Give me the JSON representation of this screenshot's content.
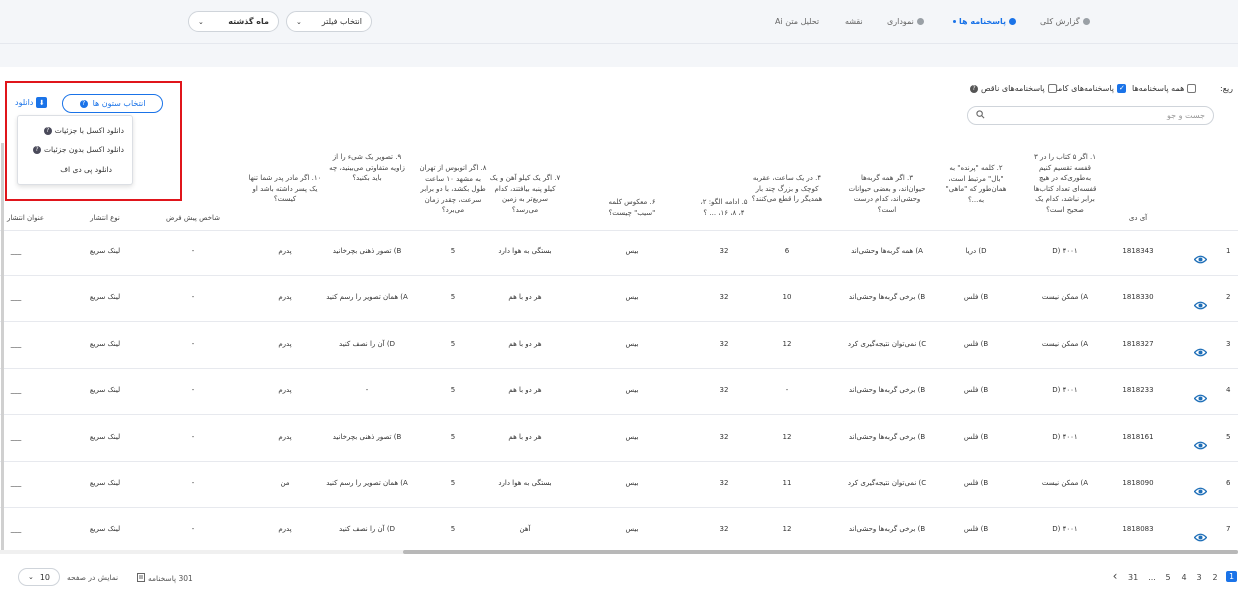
{
  "nav": {
    "tabs": [
      {
        "label": "گزارش کلی",
        "active": false
      },
      {
        "label": "پاسخنامه ها",
        "active": true
      },
      {
        "label": "نموداری",
        "active": false
      },
      {
        "label": "نقشه",
        "active": false
      },
      {
        "label": "تحلیل متن Ai",
        "active": false
      }
    ],
    "filter_select": "انتخاب فیلتر",
    "period_select": "ماه گذشته"
  },
  "filters": {
    "prefix": "ریع:",
    "all": "همه پاسخنامه‌ها",
    "complete": "پاسخنامه‌های کامل",
    "incomplete": "پاسخنامه‌های ناقص",
    "all_checked": false,
    "complete_checked": true,
    "incomplete_checked": false
  },
  "search": {
    "placeholder": "جست و جو"
  },
  "toolbar": {
    "columns_button": "انتخاب ستون ها",
    "download": "دانلود"
  },
  "download_menu": [
    {
      "label": "دانلود اکسل با جزئیات",
      "help": true
    },
    {
      "label": "دانلود اکسل بدون جزئیات",
      "help": true
    },
    {
      "label": "دانلود پی دی اف",
      "help": false
    }
  ],
  "table": {
    "headers": {
      "row": "دیف",
      "id": "آی دی",
      "q1": "۱. اگر ۵ کتاب را در ۳ قفسه تقسیم کنیم به‌طوری‌که در هیچ قفسه‌ای تعداد کتاب‌ها برابر نباشد، کدام یک صحیح است؟",
      "q2": "۲. کلمه \"پرنده\" به \"بال\" مرتبط است، همان‌طور که \"ماهی\" به...؟",
      "q3": "۳. اگر همه گربه‌ها حیوان‌اند، و بعضی حیوانات وحشی‌اند، کدام درست است؟",
      "q4": "۴. در یک ساعت، عقربه کوچک و بزرگ چند بار همدیگر را قطع می‌کنند؟",
      "q5": "۵. ادامه الگو: ۲، ۴، ۸، ۱۶، ... ؟",
      "q6": "۶. معکوس کلمه \"سیب\" چیست؟",
      "q7": "۷. اگر یک کیلو آهن و یک کیلو پنبه بیافتند، کدام سریع‌تر به زمین می‌رسد؟",
      "q8": "۸. اگر اتوبوس از تهران به مشهد ۱۰ ساعت طول بکشد، با دو برابر سرعت، چقدر زمان می‌برد؟",
      "q9": "۹. تصویر یک شیء را از زاویه متفاوتی می‌بینید، چه باید بکنید؟",
      "q10": "۱۰. اگر مادر پدر شما تنها یک پسر داشته باشد او کیست؟",
      "default_index": "شاخص پیش فرض",
      "publish_type": "نوع انتشار",
      "publish_title": "عنوان انتشار"
    },
    "rows": [
      {
        "n": "1",
        "id": "1818343",
        "q1": "D) ۴۰۰۱",
        "q2": "D) دریا",
        "q3": "A) همه گربه‌ها وحشی‌اند",
        "q4": "6",
        "q5": "32",
        "q6": "بیس",
        "q7": "بستگی به هوا دارد",
        "q8": "5",
        "q9": "B) تصور ذهنی بچرخانید",
        "q10": "پدرم",
        "idx": "-",
        "ptype": "لینک سریع",
        "ptitle": "___"
      },
      {
        "n": "2",
        "id": "1818330",
        "q1": "A) ممکن نیست",
        "q2": "B) فلس",
        "q3": "B) برخی گربه‌ها وحشی‌اند",
        "q4": "10",
        "q5": "32",
        "q6": "بیس",
        "q7": "هر دو با هم",
        "q8": "5",
        "q9": "A) همان تصویر را رسم کنید",
        "q10": "پدرم",
        "idx": "-",
        "ptype": "لینک سریع",
        "ptitle": "___"
      },
      {
        "n": "3",
        "id": "1818327",
        "q1": "A) ممکن نیست",
        "q2": "B) فلس",
        "q3": "C) نمی‌توان نتیجه‌گیری کرد",
        "q4": "12",
        "q5": "32",
        "q6": "بیس",
        "q7": "هر دو با هم",
        "q8": "5",
        "q9": "D) آن را نصف کنید",
        "q10": "پدرم",
        "idx": "-",
        "ptype": "لینک سریع",
        "ptitle": "___"
      },
      {
        "n": "4",
        "id": "1818233",
        "q1": "D) ۴۰۰۱",
        "q2": "B) فلس",
        "q3": "B) برخی گربه‌ها وحشی‌اند",
        "q4": "-",
        "q5": "32",
        "q6": "بیس",
        "q7": "هر دو با هم",
        "q8": "5",
        "q9": "-",
        "q10": "پدرم",
        "idx": "-",
        "ptype": "لینک سریع",
        "ptitle": "___"
      },
      {
        "n": "5",
        "id": "1818161",
        "q1": "D) ۴۰۰۱",
        "q2": "B) فلس",
        "q3": "B) برخی گربه‌ها وحشی‌اند",
        "q4": "12",
        "q5": "32",
        "q6": "بیس",
        "q7": "هر دو با هم",
        "q8": "5",
        "q9": "B) تصور ذهنی بچرخانید",
        "q10": "پدرم",
        "idx": "-",
        "ptype": "لینک سریع",
        "ptitle": "___"
      },
      {
        "n": "6",
        "id": "1818090",
        "q1": "A) ممکن نیست",
        "q2": "B) فلس",
        "q3": "C) نمی‌توان نتیجه‌گیری کرد",
        "q4": "11",
        "q5": "32",
        "q6": "بیس",
        "q7": "بستگی به هوا دارد",
        "q8": "5",
        "q9": "A) همان تصویر را رسم کنید",
        "q10": "من",
        "idx": "-",
        "ptype": "لینک سریع",
        "ptitle": "___"
      },
      {
        "n": "7",
        "id": "1818083",
        "q1": "D) ۴۰۰۱",
        "q2": "B) فلس",
        "q3": "B) برخی گربه‌ها وحشی‌اند",
        "q4": "12",
        "q5": "32",
        "q6": "بیس",
        "q7": "آهن",
        "q8": "5",
        "q9": "D) آن را نصف کنید",
        "q10": "پدرم",
        "idx": "-",
        "ptype": "لینک سریع",
        "ptitle": "___"
      }
    ]
  },
  "footer": {
    "per_page_value": "10",
    "per_page_label": "نمایش در صفحه",
    "total": "301 پاسخنامه",
    "pages": [
      "1",
      "2",
      "3",
      "4",
      "5",
      "...",
      "31"
    ],
    "active_page": "1"
  },
  "colors": {
    "accent": "#1a73e8",
    "highlight": "#e0151b"
  }
}
